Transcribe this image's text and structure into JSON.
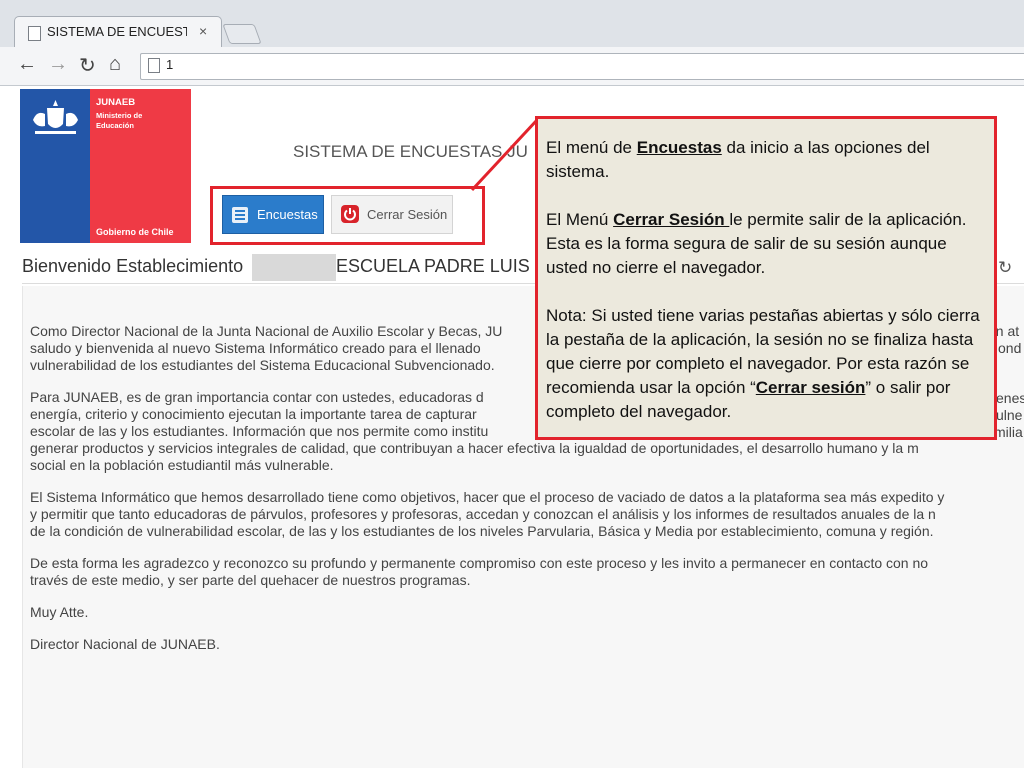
{
  "browser": {
    "tab_title": "SISTEMA DE ENCUESTAS -",
    "tab_close": "×",
    "address_text": "1",
    "nav": {
      "back": "←",
      "forward": "→",
      "reload": "↻",
      "home": "⌂"
    }
  },
  "logo": {
    "org": "JUNAEB",
    "ministry": "Ministerio de Educación",
    "government": "Gobierno de Chile"
  },
  "header": {
    "title": "SISTEMA DE ENCUESTAS  JU"
  },
  "menu": {
    "encuestas_label": "Encuestas",
    "cerrar_label": "Cerrar Sesión"
  },
  "welcome": {
    "text": "Bienvenido Establecimiento",
    "school": "ESCUELA PADRE LUIS E"
  },
  "letter": {
    "p1": "Como Director Nacional de la Junta Nacional de Auxilio Escolar y Becas, JU                                                                                         un at saludo y bienvenida al nuevo Sistema Informático creado para el llenado                                                                                          ond vulnerabilidad de los estudiantes del Sistema Educacional Subvencionado.",
    "p1_lines": [
      "Como Director Nacional de la Junta Nacional de Auxilio Escolar y Becas, JU",
      "saludo y bienvenida al nuevo Sistema Informático creado para el llenado",
      "vulnerabilidad de los estudiantes del Sistema Educacional Subvencionado."
    ],
    "p1_right": [
      "un at",
      "ond",
      ""
    ],
    "p2_lines": [
      "Para JUNAEB, es de gran importancia contar con ustedes, educadoras d",
      "energía, criterio y conocimiento ejecutan la importante tarea de capturar",
      "escolar de las y los estudiantes. Información que nos permite como institu",
      "generar productos y servicios integrales de calidad, que contribuyan a hacer efectiva la igualdad de oportunidades, el desarrollo humano y la m",
      "social en la población estudiantil más vulnerable."
    ],
    "p2_right": [
      "enes",
      "ulne",
      "milia",
      "",
      ""
    ],
    "p3_lines": [
      "El Sistema Informático que hemos desarrollado tiene como objetivos, hacer que el proceso de vaciado de datos a la plataforma sea más expedito y",
      "y permitir que tanto educadoras de párvulos, profesores y profesoras, accedan y conozcan el análisis y los informes de resultados anuales de la n",
      "de la condición de vulnerabilidad escolar, de las y los estudiantes de los niveles Parvularia, Básica y Media por establecimiento, comuna y región."
    ],
    "p4_lines": [
      "De esta forma les agradezco y reconozco su profundo y permanente compromiso con este proceso y les invito a permanecer en contacto con no",
      "través de este medio, y ser parte del quehacer de nuestros programas."
    ],
    "closing": "Muy Atte.",
    "signature": "Director Nacional de JUNAEB."
  },
  "callout": {
    "p1_before": "El menú de ",
    "p1_bold": "Encuestas",
    "p1_after": " da inicio a las opciones del sistema.",
    "p2_before": "El Menú ",
    "p2_bold": "Cerrar Sesión ",
    "p2_after": "le permite salir de la aplicación. Esta es la forma segura de salir de su sesión  aunque usted no cierre el navegador.",
    "p3_before": "Nota: Si usted tiene varias pestañas abiertas y sólo cierra la pestaña de la aplicación, la sesión no se finaliza  hasta que cierre por completo el navegador. Por esta razón se recomienda usar la opción “",
    "p3_bold": "Cerrar sesión",
    "p3_after": "” o salir por completo del navegador."
  },
  "colors": {
    "accent_red": "#e2232c",
    "button_blue": "#2b7ccb",
    "logo_blue": "#2356a8",
    "logo_red": "#ef3a45",
    "callout_bg": "#ece9dd"
  }
}
